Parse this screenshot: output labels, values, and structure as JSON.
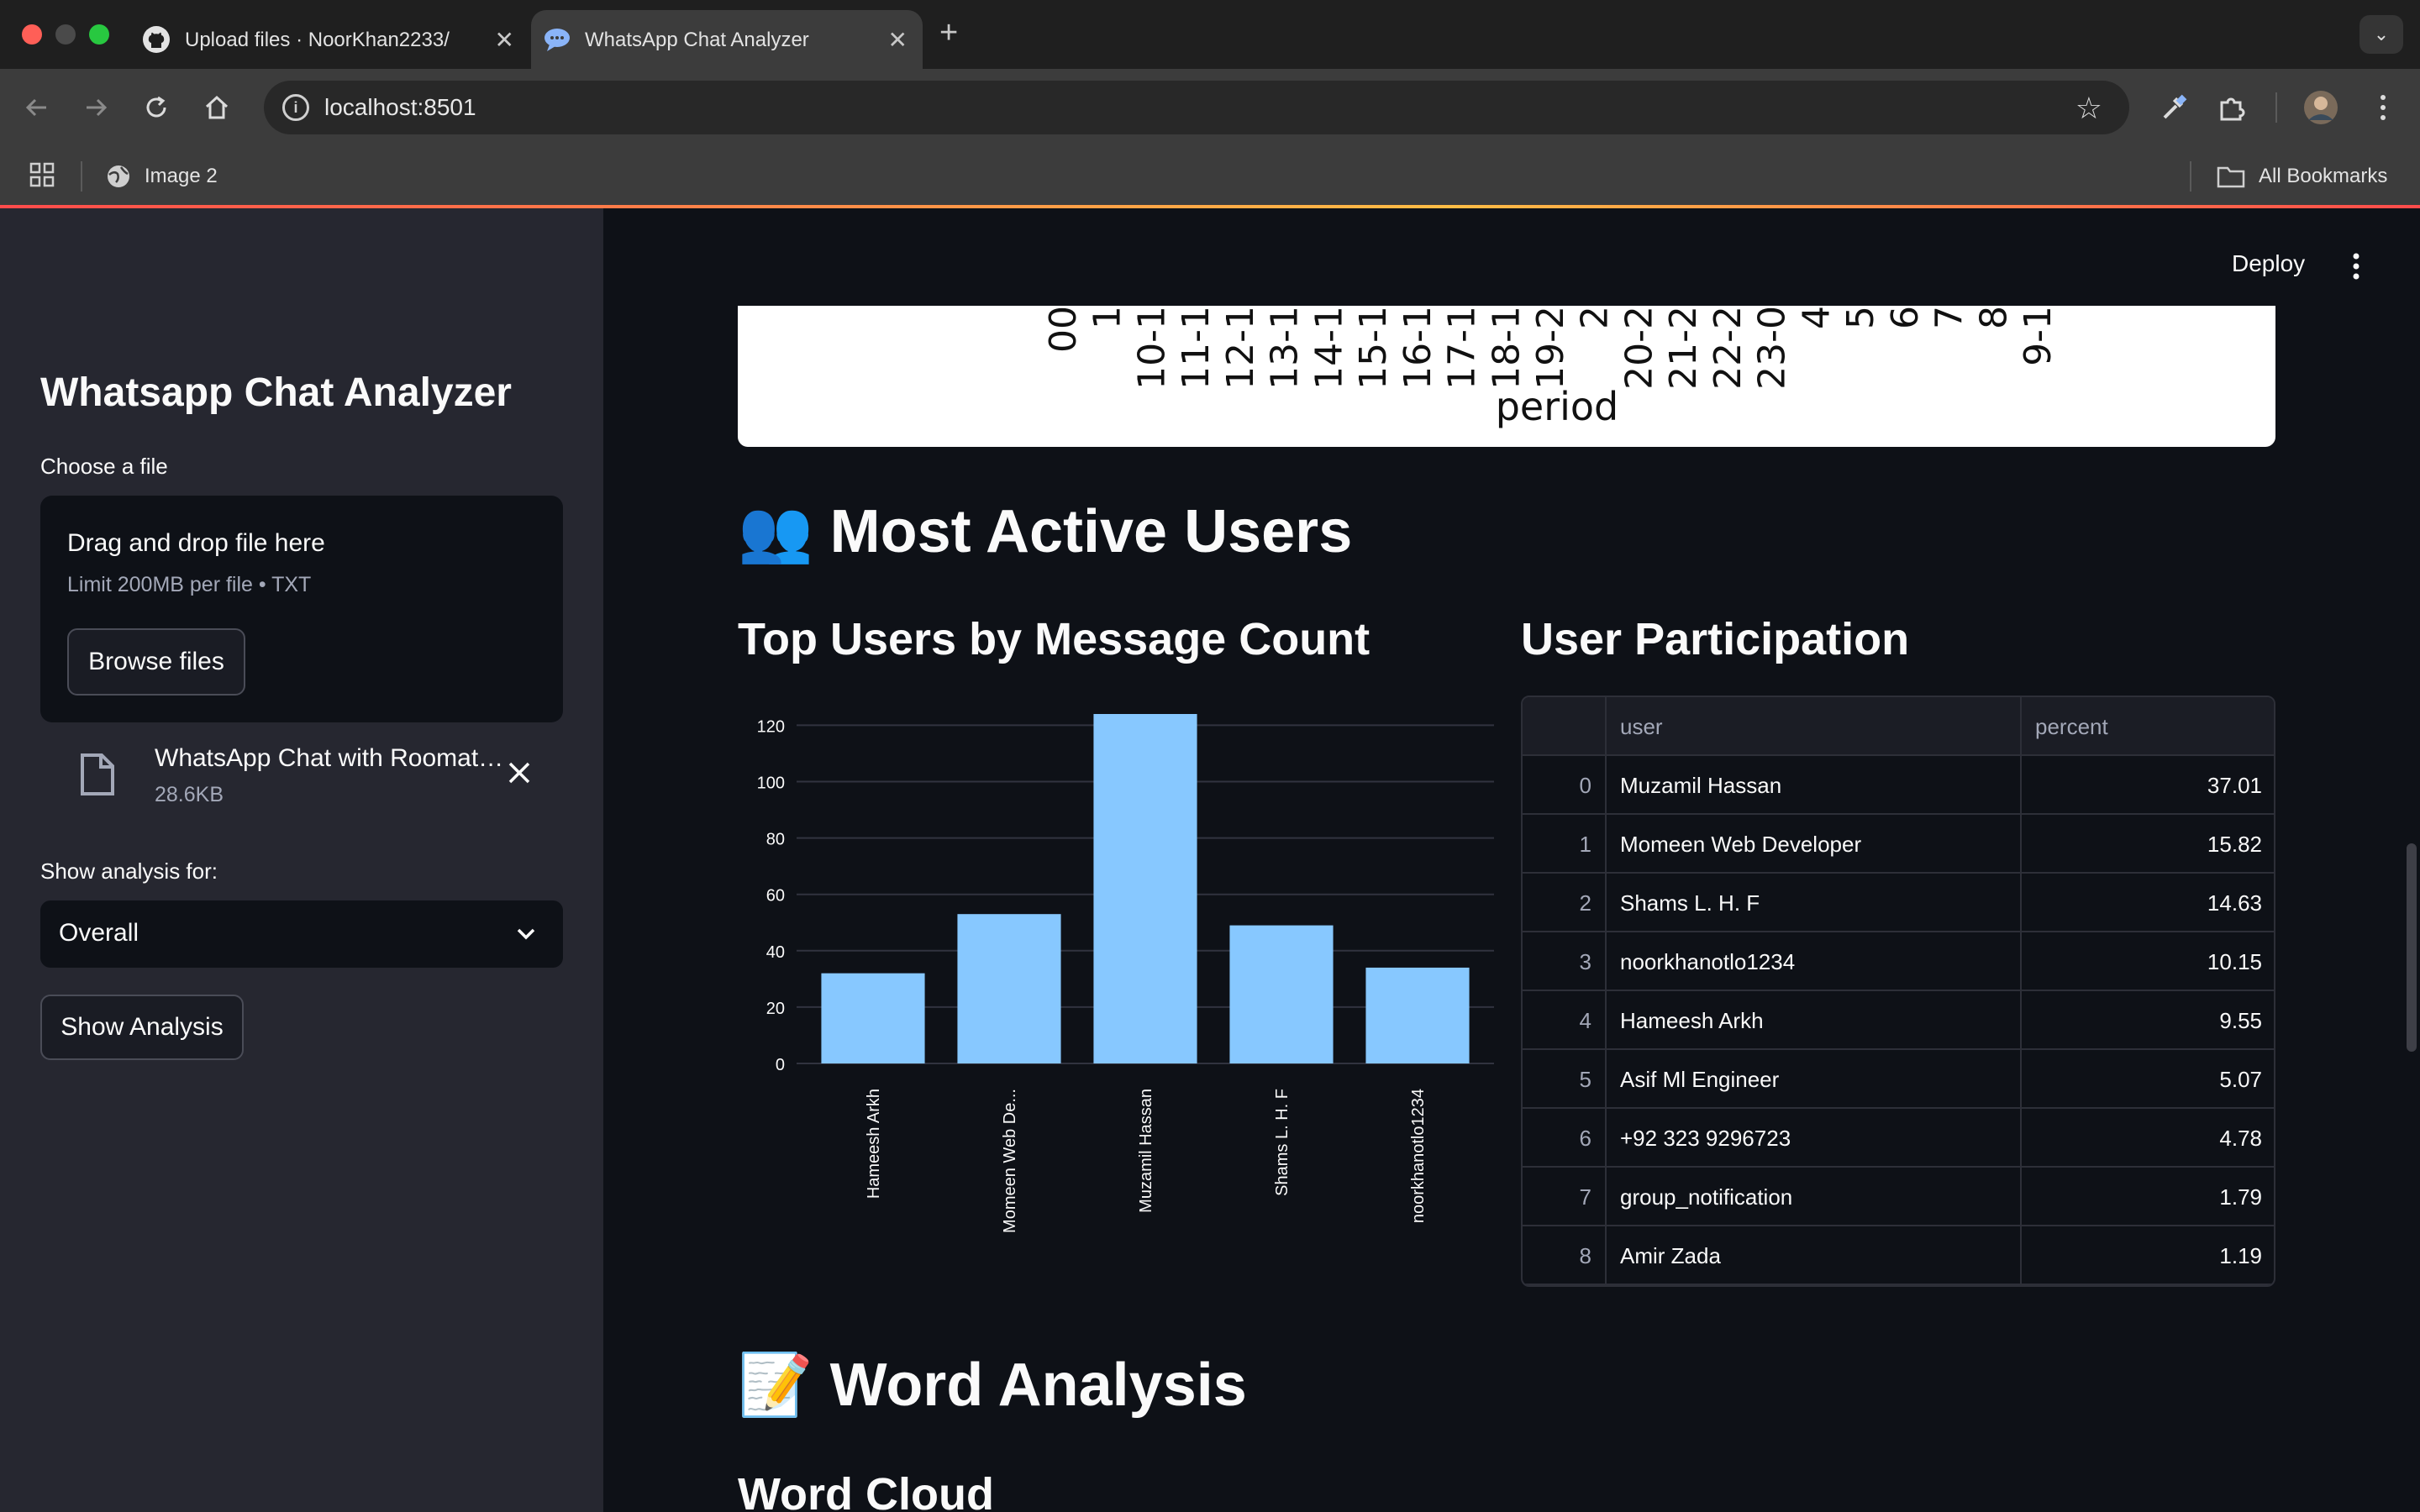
{
  "browser": {
    "tabs": [
      {
        "title": "Upload files · NoorKhan2233/",
        "icon": "github-icon",
        "active": false
      },
      {
        "title": "WhatsApp Chat Analyzer",
        "icon": "chat-bubble-icon",
        "active": true
      }
    ],
    "url": "localhost:8501",
    "bookmarks": [
      {
        "label": "Image 2"
      }
    ],
    "all_bookmarks_label": "All Bookmarks"
  },
  "sidebar": {
    "title": "Whatsapp Chat Analyzer",
    "file_label": "Choose a file",
    "uploader": {
      "drag_text": "Drag and drop file here",
      "limit_text": "Limit 200MB per file • TXT",
      "browse_label": "Browse files"
    },
    "uploaded_file": {
      "name": "WhatsApp Chat with Roomat…",
      "size": "28.6KB"
    },
    "analysis_label": "Show analysis for:",
    "analysis_selected": "Overall",
    "show_button": "Show Analysis"
  },
  "header": {
    "deploy_label": "Deploy"
  },
  "period_chart": {
    "tick_labels": [
      "00",
      "1",
      "10-1",
      "11-1",
      "12-1",
      "13-1",
      "14-1",
      "15-1",
      "16-1",
      "17-1",
      "18-1",
      "19-2",
      "2",
      "20-2",
      "21-2",
      "22-2",
      "23-0",
      "4",
      "5",
      "6",
      "7",
      "8",
      "9-1"
    ],
    "xlabel": "period"
  },
  "sections": {
    "active_users": {
      "emoji": "👥",
      "title": "Most Active Users"
    },
    "word_analysis": {
      "emoji": "📝",
      "title": "Word Analysis"
    },
    "word_cloud": "Word Cloud"
  },
  "chart_data": {
    "type": "bar",
    "title": "Top Users by Message Count",
    "categories": [
      "Hameesh Arkh",
      "Momeen Web De...",
      "Muzamil Hassan",
      "Shams L. H. F",
      "noorkhanotlo1234"
    ],
    "values": [
      32,
      53,
      124,
      49,
      34
    ],
    "ylim": [
      0,
      124
    ],
    "yticks": [
      0,
      20,
      40,
      60,
      80,
      100,
      120
    ],
    "grid": true,
    "bar_color": "#87c8ff"
  },
  "participation": {
    "title": "User Participation",
    "columns": [
      "",
      "user",
      "percent"
    ],
    "rows": [
      {
        "idx": "0",
        "user": "Muzamil Hassan",
        "percent": "37.01"
      },
      {
        "idx": "1",
        "user": "Momeen Web Developer",
        "percent": "15.82"
      },
      {
        "idx": "2",
        "user": "Shams L. H. F",
        "percent": "14.63"
      },
      {
        "idx": "3",
        "user": "noorkhanotlo1234",
        "percent": "10.15"
      },
      {
        "idx": "4",
        "user": "Hameesh Arkh",
        "percent": "9.55"
      },
      {
        "idx": "5",
        "user": "Asif Ml Engineer",
        "percent": "5.07"
      },
      {
        "idx": "6",
        "user": "+92 323 9296723",
        "percent": "4.78"
      },
      {
        "idx": "7",
        "user": "group_notification",
        "percent": "1.79"
      },
      {
        "idx": "8",
        "user": "Amir Zada",
        "percent": "1.19"
      }
    ]
  },
  "colors": {
    "app_bg": "#0e1117",
    "sidebar_bg": "#262730",
    "accent": "#ff4b4b"
  }
}
